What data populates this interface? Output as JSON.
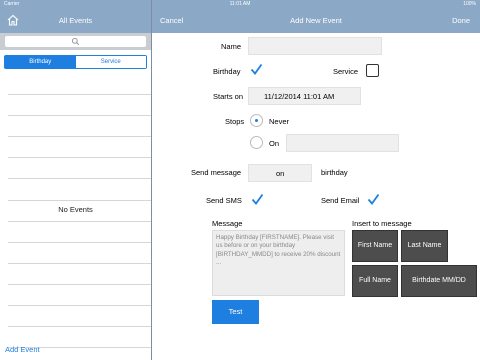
{
  "status_bar": {
    "carrier": "Carrier",
    "time": "11:01 AM",
    "battery": "100%"
  },
  "left_nav": {
    "title": "All Events"
  },
  "segments": {
    "birthday": "Birthday",
    "service": "Service"
  },
  "list": {
    "empty_text": "No Events",
    "add_event": "Add Event"
  },
  "right_nav": {
    "cancel": "Cancel",
    "title": "Add New Event",
    "done": "Done"
  },
  "form": {
    "name_label": "Name",
    "name_value": "",
    "birthday_label": "Birthday",
    "birthday_checked": true,
    "service_label": "Service",
    "service_checked": false,
    "starts_on_label": "Starts on",
    "starts_on_value": "11/12/2014 11:01 AM",
    "stops_label": "Stops",
    "never_label": "Never",
    "on_label": "On",
    "on_date_value": "",
    "send_message_label": "Send message",
    "send_message_value": "on",
    "birthday_suffix": "birthday",
    "send_sms_label": "Send SMS",
    "send_sms_checked": true,
    "send_email_label": "Send Email",
    "send_email_checked": true,
    "message_label": "Message",
    "message_placeholder": "Happy Birthday [FIRSTNAME]. Please visit us before or on your birthday [BIRTHDAY_MMDD] to receive 20% discount ...",
    "insert_label": "Insert to message",
    "insert_buttons": [
      "First Name",
      "Last Name",
      "Full Name",
      "Birthdate MM/DD"
    ],
    "test_button": "Test"
  },
  "colors": {
    "accent": "#1f7fe0",
    "navbar": "#8ba9c7",
    "insert_button": "#4d4d4d"
  }
}
